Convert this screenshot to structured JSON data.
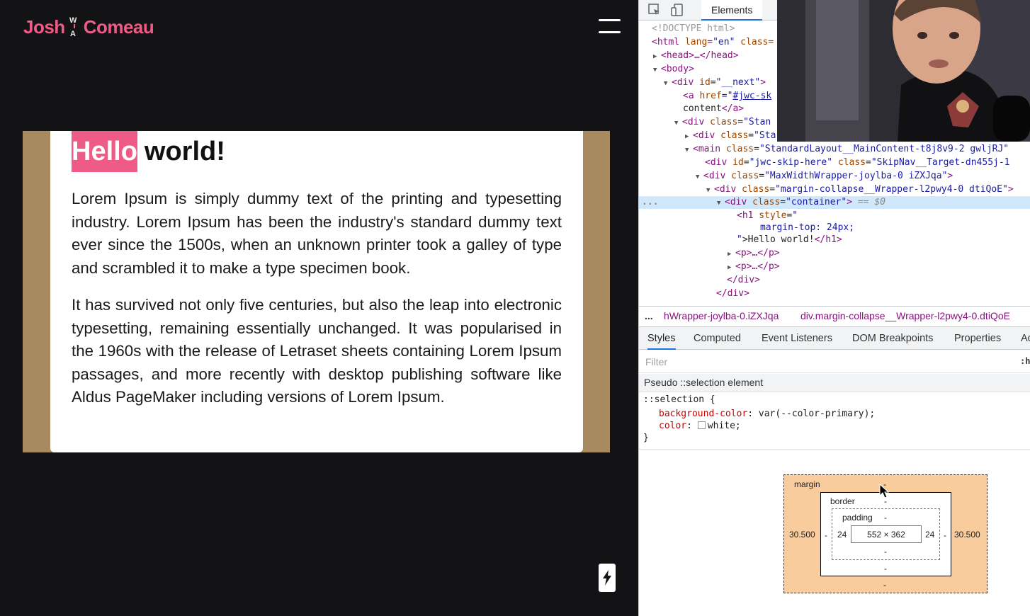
{
  "site": {
    "logo": {
      "first": "Josh",
      "last": "Comeau",
      "mark_top": "W",
      "mark_bottom": "A"
    },
    "article": {
      "heading_selected": "Hello",
      "heading_rest": "world!",
      "paragraph_1": "Lorem Ipsum is simply dummy text of the printing and typesetting industry. Lorem Ipsum has been the industry's standard dummy text ever since the 1500s, when an unknown printer took a galley of type and scrambled it to make a type specimen book.",
      "paragraph_2": "It has survived not only five centuries, but also the leap into electronic typesetting, remaining essentially unchanged. It was popularised in the 1960s with the release of Letraset sheets containing Lorem Ipsum passages, and more recently with desktop publishing software like Aldus PageMaker including versions of Lorem Ipsum."
    },
    "colors": {
      "primary": "#ef5b87",
      "frame": "#a78a5f",
      "background": "#131315"
    }
  },
  "devtools": {
    "tabs": {
      "elements": "Elements"
    },
    "dom": {
      "l01": "<!DOCTYPE html>",
      "l02_tag": "<html",
      "l02_attr": " lang",
      "l02_eq": "=",
      "l02_val": "\"en\"",
      "l02_attr2": " class=",
      "l03": "<head>…</head>",
      "l04": "<body>",
      "l05_tag": "<div",
      "l05_attr": " id",
      "l05_val": "\"__next\"",
      "l05_end": ">",
      "l06_tag": "<a",
      "l06_attr": " href",
      "l06_val_q": "=\"",
      "l06_link": "#jwc-sk",
      "l07_text": "content",
      "l07_tag": "</a>",
      "l08_tag": "<div",
      "l08_attr": " class",
      "l08_val": "\"Stan",
      "l09_tag": "<div",
      "l09_attr": " class",
      "l09_val": "\"Sta",
      "l10_tag": "<main",
      "l10_attr": " class",
      "l10_val": "\"StandardLayout__MainContent-t8j8v9-2 gwljRJ\"",
      "l11_tag": "<div",
      "l11_attr": " id",
      "l11_val": "\"jwc-skip-here\"",
      "l11_attr2": " class",
      "l11_val2": "\"SkipNav__Target-dn455j-1",
      "l12_tag": "<div",
      "l12_attr": " class",
      "l12_val": "\"MaxWidthWrapper-joylba-0 iZXJqa\"",
      "l12_end": ">",
      "l13_tag": "<div",
      "l13_attr": " class",
      "l13_val": "\"margin-collapse__Wrapper-l2pwy4-0 dtiQoE\"",
      "l13_end": ">",
      "l14_dots": "...",
      "l14_tag": "<div",
      "l14_attr": " class",
      "l14_val": "\"container\"",
      "l14_end": ">",
      "l14_eq": " == ",
      "l14_ref": "$0",
      "l15_tag": "<h1",
      "l15_attr": " style",
      "l15_val": "\"",
      "l16_val": "margin-top: 24px;",
      "l17_val": "\"",
      "l17_text": ">Hello world!",
      "l17_tag": "</h1>",
      "l18": "<p>…</p>",
      "l19": "<p>…</p>",
      "l20": "</div>",
      "l21": "</div>"
    },
    "breadcrumbs": {
      "dots": "...",
      "item_1": "hWrapper-joylba-0.iZXJqa",
      "item_2": "div.margin-collapse__Wrapper-l2pwy4-0.dtiQoE"
    },
    "styles_tabs": [
      "Styles",
      "Computed",
      "Event Listeners",
      "DOM Breakpoints",
      "Properties",
      "Ac"
    ],
    "filter": {
      "placeholder": "Filter",
      "hov": ":h"
    },
    "pseudo_header": "Pseudo ::selection element",
    "rule": {
      "selector": "::selection {",
      "prop_1": "background-color",
      "val_1": "var(--color-primary);",
      "prop_2": "color",
      "val_2": "white;",
      "close": "}"
    },
    "box_model": {
      "margin_label": "margin",
      "margin_top": "-",
      "margin_bottom": "-",
      "margin_left": "30.500",
      "margin_right": "30.500",
      "border_label": "border",
      "border_top": "-",
      "border_bottom": "-",
      "border_left": "-",
      "border_right": "-",
      "padding_label": "padding",
      "padding_top": "-",
      "padding_bottom": "-",
      "padding_left": "24",
      "padding_right": "24",
      "content_size": "552 × 362"
    }
  }
}
